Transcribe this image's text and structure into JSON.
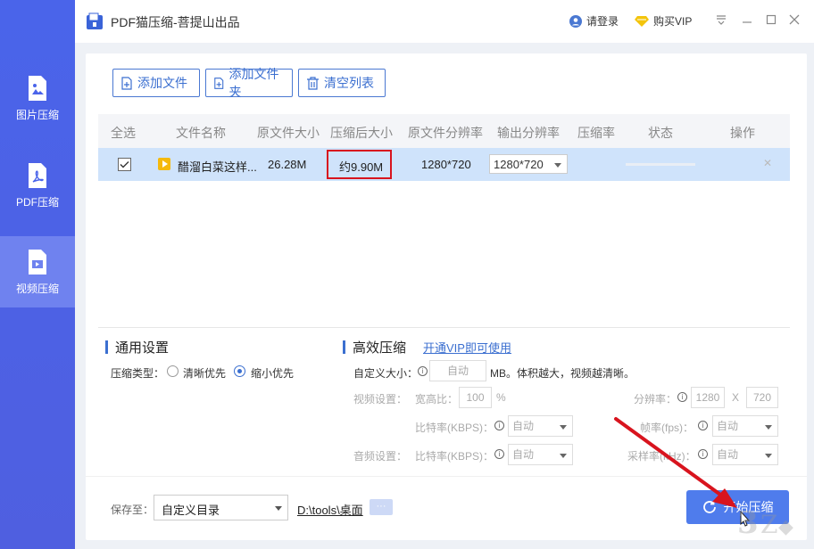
{
  "app": {
    "title": "PDF猫压缩-菩提山出品",
    "login": "请登录",
    "vip": "购买VIP"
  },
  "sidebar": {
    "items": [
      {
        "label": "图片压缩",
        "active": false
      },
      {
        "label": "PDF压缩",
        "active": false
      },
      {
        "label": "视频压缩",
        "active": true
      }
    ]
  },
  "toolbar": {
    "add_file": "添加文件",
    "add_folder": "添加文件夹",
    "clear_list": "清空列表"
  },
  "table": {
    "headers": [
      "全选",
      "文件名称",
      "原文件大小",
      "压缩后大小",
      "原文件分辨率",
      "输出分辨率",
      "压缩率",
      "状态",
      "操作"
    ],
    "rows": [
      {
        "checked": true,
        "name": "醋溜白菜这样...",
        "orig_size": "26.28M",
        "compressed_size": "约9.90M",
        "orig_res": "1280*720",
        "out_res": "1280*720",
        "rate": "",
        "status": "",
        "progress": 0
      }
    ]
  },
  "general": {
    "title": "通用设置",
    "type_label": "压缩类型：",
    "opt_clear": "清晰优先",
    "opt_small": "缩小优先",
    "selected": "缩小优先"
  },
  "efficient": {
    "title": "高效压缩",
    "vip_link": "开通VIP即可使用",
    "custom_label": "自定义大小：",
    "custom_value": "自动",
    "custom_hint": "MB。体积越大，视频越清晰。",
    "video_label": "视频设置：",
    "aspect_label": "宽高比：",
    "aspect_value": "100",
    "aspect_unit": "%",
    "resolution_label": "分辨率：",
    "res_w": "1280",
    "res_x": "X",
    "res_h": "720",
    "bitrate_label": "比特率(KBPS)：",
    "bitrate_value": "自动",
    "fps_label": "帧率(fps)：",
    "fps_value": "自动",
    "audio_label": "音频设置：",
    "audio_bitrate_label": "比特率(KBPS)：",
    "audio_bitrate_value": "自动",
    "samplerate_label": "采样率(kHz)：",
    "samplerate_value": "自动"
  },
  "footer": {
    "save_label": "保存至：",
    "save_option": "自定义目录",
    "path": "D:\\tools\\桌面",
    "dots": "···",
    "start": "开始压缩"
  },
  "colors": {
    "sidebar": "#4a64ea",
    "accent": "#3b6fd0",
    "highlight_box": "#d8141e",
    "arrow": "#d8141e"
  }
}
